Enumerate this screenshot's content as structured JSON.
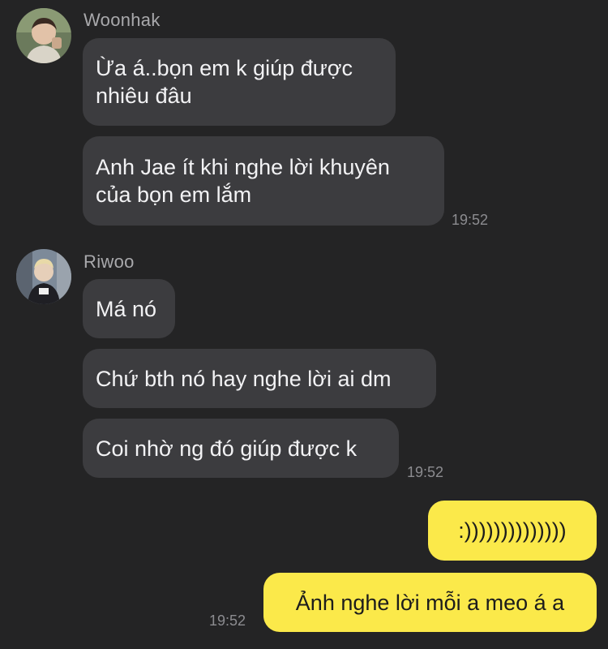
{
  "theme": {
    "background": "#242425",
    "incoming_bubble": "#3c3c3f",
    "outgoing_bubble": "#fbe94a",
    "sender_name_color": "#a9a9ac",
    "timestamp_color": "#8c8c90"
  },
  "messages": {
    "group1": {
      "sender": "Woonhak",
      "bubble1": "Ừa á..bọn em k giúp được\nnhiêu đâu",
      "bubble2": "Anh Jae ít khi nghe lời khuyên\ncủa bọn em lắm",
      "time": "19:52"
    },
    "group2": {
      "sender": "Riwoo",
      "bubble1": "Má nó",
      "bubble2": "Chứ bth nó hay nghe lời ai dm",
      "bubble3": "Coi nhờ ng đó giúp được k",
      "time": "19:52"
    },
    "group3": {
      "bubble1": ":))))))))))))))",
      "bubble2": "Ảnh nghe lời mỗi a meo á a",
      "time": "19:52"
    }
  }
}
